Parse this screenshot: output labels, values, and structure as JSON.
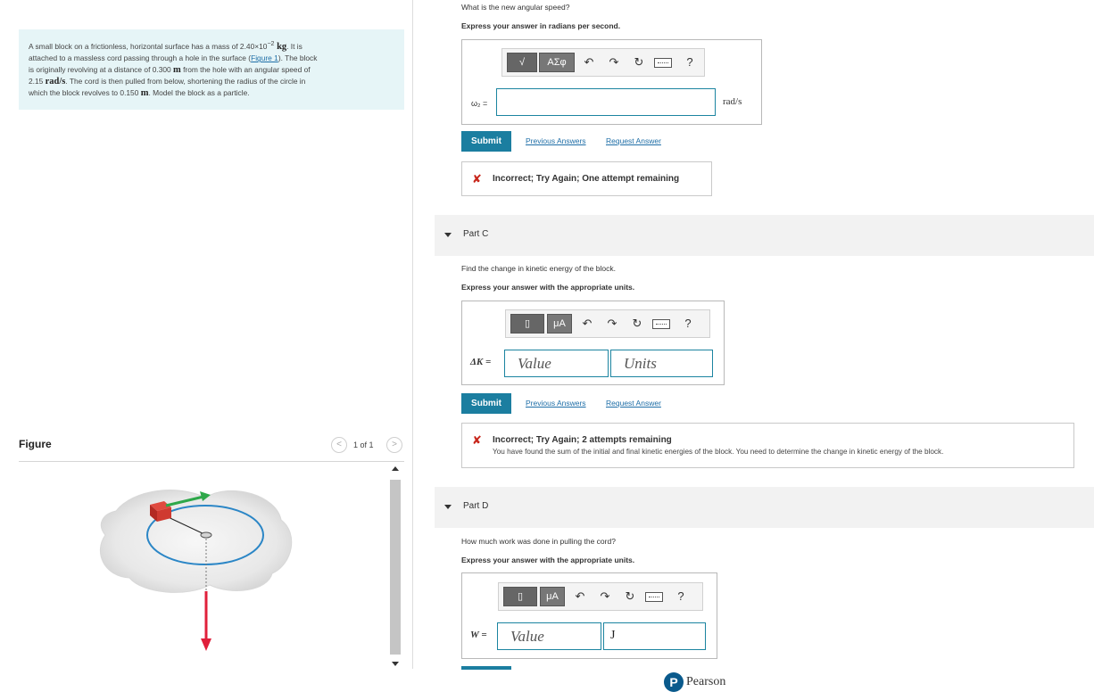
{
  "problem": {
    "text_1": "A small block on a frictionless, horizontal surface has a mass of 2.40×10",
    "text_1_exp": "−2",
    "text_1_unit": " kg",
    "text_1_tail": ". It is",
    "text_2": "attached to a massless cord passing through a hole in the surface (",
    "figure_link": "Figure 1",
    "text_2_tail": "). The block",
    "text_3": "is originally revolving at a distance of 0.300 ",
    "text_3_unit": "m",
    "text_3_tail": " from the hole with an angular speed of",
    "text_4": "2.15 ",
    "text_4_unit": "rad/s",
    "text_4_tail": ". The cord is then pulled from below, shortening the radius of the circle in",
    "text_5": "which the block revolves to 0.150 ",
    "text_5_unit": "m",
    "text_5_tail": ". Model the block as a particle."
  },
  "figure": {
    "title": "Figure",
    "counter": "1 of 1",
    "prev_glyph": "<",
    "next_glyph": ">"
  },
  "part_b": {
    "question": "What is the new angular speed?",
    "instruction": "Express your answer in radians per second.",
    "toolbar": {
      "templates": "√",
      "greek": "ΑΣφ",
      "undo": "↶",
      "redo": "↷",
      "reset": "↻",
      "help": "?"
    },
    "label": "ω₂ =",
    "unit": "rad/s",
    "submit": "Submit",
    "previous_answers": "Previous Answers",
    "request_answer": "Request Answer",
    "feedback": "Incorrect; Try Again; One attempt remaining",
    "feedback_icon": "✘"
  },
  "part_c": {
    "part_label": "Part C",
    "question": "Find the change in kinetic energy of the block.",
    "instruction": "Express your answer with the appropriate units.",
    "toolbar": {
      "templates": "▯",
      "units": "μA",
      "undo": "↶",
      "redo": "↷",
      "reset": "↻",
      "help": "?"
    },
    "label": "ΔK =",
    "value_placeholder": "Value",
    "units_placeholder": "Units",
    "submit": "Submit",
    "previous_answers": "Previous Answers",
    "request_answer": "Request Answer",
    "feedback": "Incorrect; Try Again; 2 attempts remaining",
    "feedback_detail": "You have found the sum of the initial and final kinetic energies of the block. You need to determine the change in kinetic energy of the block.",
    "feedback_icon": "✘"
  },
  "part_d": {
    "part_label": "Part D",
    "question": "How much work was done in pulling the cord?",
    "instruction": "Express your answer with the appropriate units.",
    "toolbar": {
      "templates": "▯",
      "units": "μA",
      "undo": "↶",
      "redo": "↷",
      "reset": "↻",
      "help": "?"
    },
    "label": "W =",
    "value_placeholder": "Value",
    "units_value": "J"
  },
  "footer": {
    "logo_letter": "P",
    "brand": "Pearson"
  },
  "colors": {
    "accent": "#1b7ea0",
    "problem_bg": "#e6f5f7",
    "error": "#c8261b",
    "link": "#1e6ea7"
  }
}
